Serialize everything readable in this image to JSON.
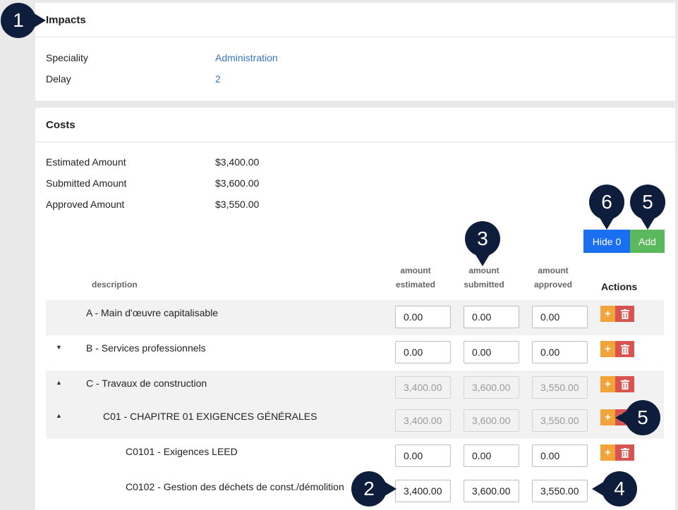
{
  "impacts": {
    "title": "Impacts",
    "rows": [
      {
        "label": "Speciality",
        "value": "Administration"
      },
      {
        "label": "Delay",
        "value": "2"
      }
    ]
  },
  "costs": {
    "title": "Costs",
    "summary": [
      {
        "label": "Estimated Amount",
        "value": "$3,400.00"
      },
      {
        "label": "Submitted Amount",
        "value": "$3,600.00"
      },
      {
        "label": "Approved Amount",
        "value": "$3,550.00"
      }
    ],
    "hide_label": "Hide 0",
    "add_label": "Add",
    "columns": {
      "description": "description",
      "estimated_1": "amount",
      "estimated_2": "estimated",
      "submitted_1": "amount",
      "submitted_2": "submitted",
      "approved_1": "amount",
      "approved_2": "approved",
      "actions": "Actions"
    },
    "rows": [
      {
        "desc": "A - Main d'œuvre capitalisable",
        "est": "0.00",
        "sub": "0.00",
        "app": "0.00"
      },
      {
        "desc": "B - Services professionnels",
        "est": "0.00",
        "sub": "0.00",
        "app": "0.00"
      },
      {
        "desc": "C - Travaux de construction",
        "est": "3,400.00",
        "sub": "3,600.00",
        "app": "3,550.00"
      },
      {
        "desc": "C01 - CHAPITRE 01  EXIGENCES GÉNÉRALES",
        "est": "3,400.00",
        "sub": "3,600.00",
        "app": "3,550.00"
      },
      {
        "desc": "C0101 - Exigences LEED",
        "est": "0.00",
        "sub": "0.00",
        "app": "0.00"
      },
      {
        "desc": "C0102 - Gestion des déchets de const./démolition",
        "est": "3,400.00",
        "sub": "3,600.00",
        "app": "3,550.00"
      }
    ],
    "plus_glyph": "+"
  },
  "callouts": [
    "1",
    "6",
    "5",
    "3",
    "5",
    "2",
    "4"
  ],
  "colors": {
    "link": "#3a75c4",
    "hide_button": "#1a6ef0",
    "add_button": "#5cb85c",
    "plus": "#f0a43a",
    "delete": "#d9534f",
    "callout": "#0f1d3c"
  }
}
